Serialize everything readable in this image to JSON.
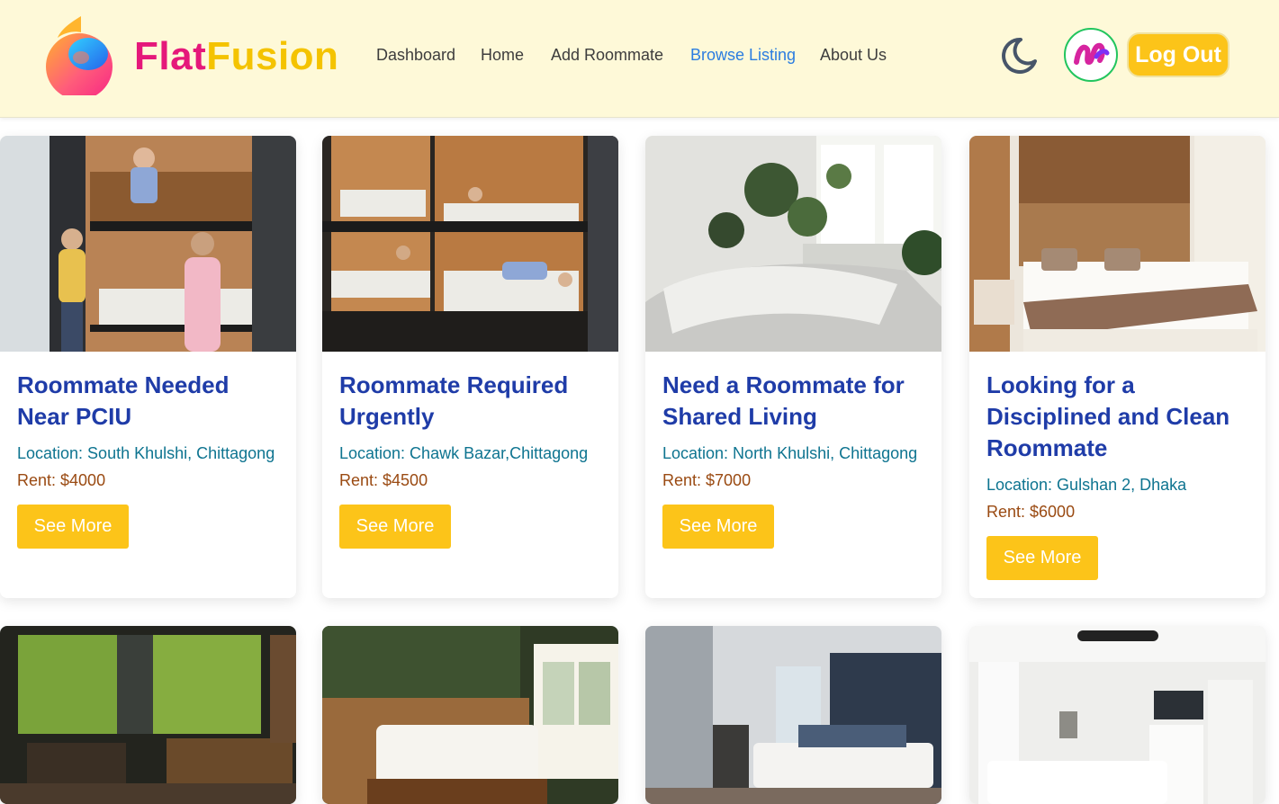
{
  "brand": {
    "part1": "Flat",
    "part2": "Fusion"
  },
  "nav": [
    {
      "label": "Dashboard",
      "active": false
    },
    {
      "label": "Home",
      "active": false
    },
    {
      "label": "Add Roommate",
      "active": false
    },
    {
      "label": "Browse Listing",
      "active": true
    },
    {
      "label": "About Us",
      "active": false
    }
  ],
  "header": {
    "theme_icon": "moon-icon",
    "logout_label": "Log Out"
  },
  "colors": {
    "header_bg": "#fef9d8",
    "accent": "#fcc419",
    "title": "#1f3ca8",
    "location": "#0e7490",
    "rent": "#9a4a12",
    "brand_pink": "#e5187a",
    "brand_yellow": "#f4c300",
    "nav_active": "#2b7de0"
  },
  "listings": [
    {
      "title": "Roommate Needed Near PCIU",
      "location": "Location: South Khulshi, Chittagong",
      "rent": "Rent: $4000",
      "button": "See More"
    },
    {
      "title": "Roommate Required Urgently",
      "location": "Location: Chawk Bazar,Chittagong",
      "rent": "Rent: $4500",
      "button": "See More"
    },
    {
      "title": "Need a Roommate for Shared Living",
      "location": "Location: North Khulshi, Chittagong",
      "rent": "Rent: $7000",
      "button": "See More"
    },
    {
      "title": "Looking for a Disciplined and Clean Roommate",
      "location": "Location: Gulshan 2, Dhaka",
      "rent": "Rent: $6000",
      "button": "See More"
    }
  ]
}
